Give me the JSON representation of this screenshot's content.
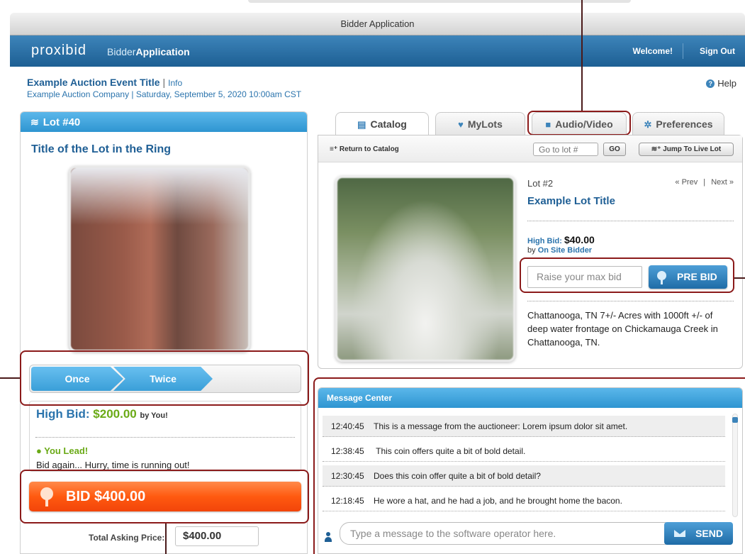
{
  "window": {
    "title": "Bidder Application"
  },
  "appbar": {
    "logo": "proxibid",
    "sub_light": "Bidder",
    "sub_bold": "Application",
    "welcome": "Welcome!",
    "signout": "Sign Out"
  },
  "event": {
    "title": "Example Auction Event Title",
    "pipe": "|",
    "info": "Info",
    "subtitle": "Example Auction Company  |  Saturday, September 5, 2020 10:00am CST"
  },
  "help": {
    "label": "Help"
  },
  "live_lot": {
    "header": "Lot #40",
    "title": "Title of the Lot in the Ring",
    "steps": [
      "Once",
      "Twice"
    ],
    "high_bid_label": "High Bid:",
    "high_bid_amount": "$200.00",
    "high_bid_by": "by You!",
    "lead_status": "You Lead!",
    "lead_message": "Bid again... Hurry, time is running out!",
    "bid_button": "BID $400.00",
    "total_label": "Total Asking Price:",
    "total_value": "$400.00"
  },
  "tabs": [
    {
      "label": "Catalog",
      "icon": "list-icon"
    },
    {
      "label": "MyLots",
      "icon": "heart-icon"
    },
    {
      "label": "Audio/Video",
      "icon": "video-icon"
    },
    {
      "label": "Preferences",
      "icon": "gear-icon"
    }
  ],
  "catalog": {
    "return_label": "Return to Catalog",
    "goto_placeholder": "Go to lot #",
    "go_label": "GO",
    "jump_label": "Jump To Live Lot",
    "lot_number": "Lot #2",
    "prev": "« Prev",
    "sep": "|",
    "next": "Next »",
    "title": "Example Lot Title",
    "high_bid_label": "High Bid:",
    "high_bid_amount": "$40.00",
    "by_label": "by",
    "bidder": "On Site Bidder",
    "maxbid_placeholder": "Raise your max bid",
    "prebid_label": "PRE BID",
    "description": "Chattanooga,  TN 7+/- Acres with 1000ft +/- of deep water frontage on Chickamauga Creek in Chattanooga, TN."
  },
  "messages": {
    "header": "Message Center",
    "rows": [
      {
        "time": "12:40:45",
        "text": "This is a message from the auctioneer: Lorem ipsum dolor sit amet."
      },
      {
        "time": "12:38:45",
        "text": " This coin offers quite a bit of bold detail."
      },
      {
        "time": "12:30:45",
        "text": "Does this coin offer quite a bit of bold detail?"
      },
      {
        "time": "12:18:45",
        "text": "He wore a hat, and he had a job, and he brought home the bacon."
      }
    ],
    "input_placeholder": "Type a message to the software operator here.",
    "send_label": "SEND"
  },
  "colors": {
    "brand_blue": "#1d5f93",
    "accent_green": "#6aaa16",
    "bid_orange": "#ff5a10",
    "highlight_red": "#8b1a1a"
  }
}
